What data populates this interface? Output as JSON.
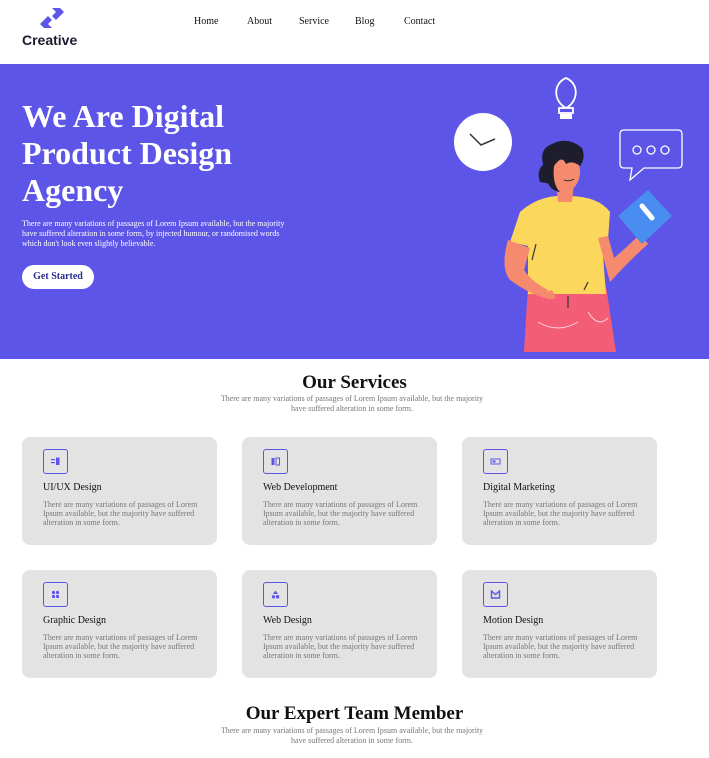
{
  "brand": {
    "name": "Creative"
  },
  "nav": {
    "items": [
      {
        "label": "Home"
      },
      {
        "label": "About"
      },
      {
        "label": "Service"
      },
      {
        "label": "Blog"
      },
      {
        "label": "Contact"
      }
    ]
  },
  "hero": {
    "title": "We Are Digital Product Design Agency",
    "text": "There are many variations of passages of Lorem Ipsum available, but the majority have suffered alteration in some form, by injected humour, or randomised words which don't look even slightly believable.",
    "cta_label": "Get Started",
    "illustration_icon": "person-holding-book-illustration"
  },
  "services": {
    "title": "Our Services",
    "subtitle": "There are many variations of passages of Lorem Ipsum available, but the majority have suffered alteration in some form.",
    "cards": [
      {
        "title": "UI/UX Design",
        "text": "There are many variations of passages of Lorem Ipsum available, but the majority have suffered alteration in some form.",
        "icon": "layout-icon"
      },
      {
        "title": "Web Development",
        "text": "There are many variations of passages of Lorem Ipsum available, but the majority have suffered alteration in some form.",
        "icon": "code-icon"
      },
      {
        "title": "Digital Marketing",
        "text": "There are many variations of passages of Lorem Ipsum available, but the majority have suffered alteration in some form.",
        "icon": "megaphone-icon"
      },
      {
        "title": "Graphic Design",
        "text": "There are many variations of passages of Lorem Ipsum available, but the majority have suffered alteration in some form.",
        "icon": "grid-icon"
      },
      {
        "title": "Web Design",
        "text": "There are many variations of passages of Lorem Ipsum available, but the majority have suffered alteration in some form.",
        "icon": "shapes-icon"
      },
      {
        "title": "Motion Design",
        "text": "There are many variations of passages of Lorem Ipsum available, but the majority have suffered alteration in some form.",
        "icon": "motion-icon"
      }
    ]
  },
  "team": {
    "title": "Our Expert Team Member",
    "subtitle": "There are many variations of passages of Lorem Ipsum available, but the majority have suffered alteration in some form."
  },
  "colors": {
    "primary": "#5c55e8",
    "card_bg": "#e3e3e3",
    "shirt": "#fbd75b",
    "skirt": "#f45d76",
    "skin": "#f58a6f"
  }
}
